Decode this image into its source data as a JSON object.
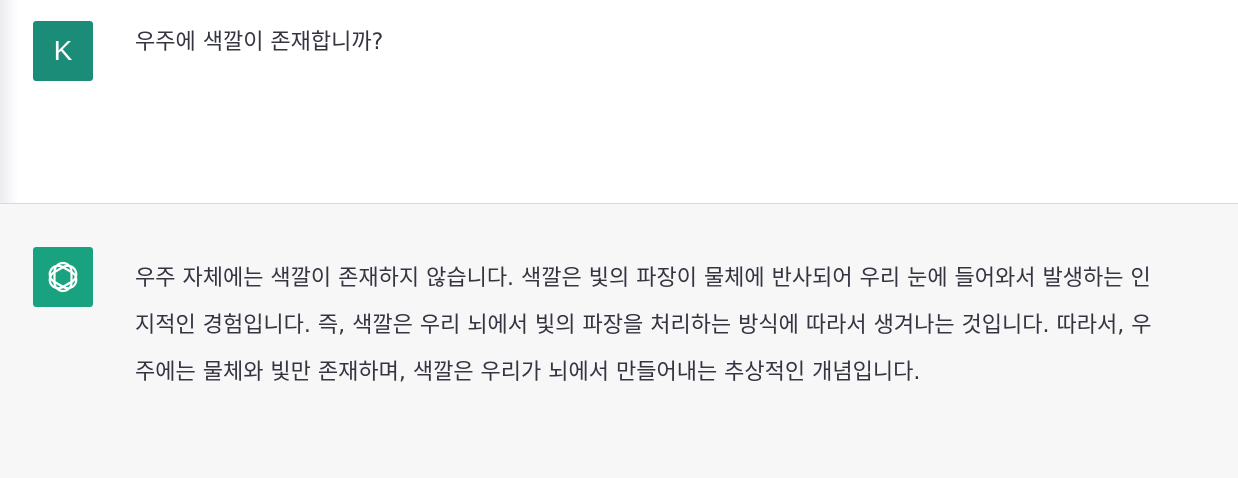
{
  "conversation": {
    "user": {
      "avatar_letter": "K",
      "message": "우주에 색깔이 존재합니까?"
    },
    "assistant": {
      "avatar_icon": "openai-logo-icon",
      "message": "우주 자체에는 색깔이 존재하지 않습니다. 색깔은 빛의 파장이 물체에 반사되어 우리 눈에 들어와서 발생하는 인지적인 경험입니다. 즉, 색깔은 우리 뇌에서 빛의 파장을 처리하는 방식에 따라서 생겨나는 것입니다. 따라서, 우주에는 물체와 빛만 존재하며, 색깔은 우리가 뇌에서 만들어내는 추상적인 개념입니다."
    }
  },
  "colors": {
    "user_avatar_bg": "#1a8c78",
    "assistant_avatar_bg": "#19a27f",
    "assistant_row_bg": "#f7f7f8",
    "text": "#343541"
  }
}
